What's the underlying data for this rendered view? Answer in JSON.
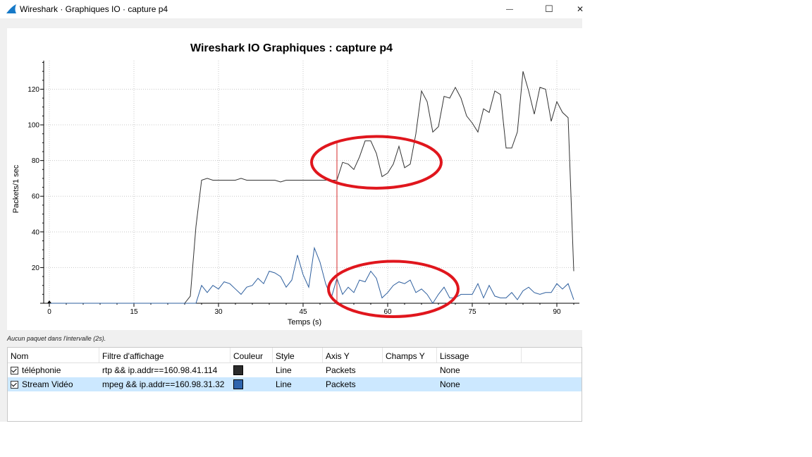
{
  "window": {
    "title": "Wireshark · Graphiques IO · capture p4",
    "minimize_glyph": "—",
    "maximize_glyph": "☐",
    "close_glyph": "✕"
  },
  "graph": {
    "title": "Wireshark IO Graphiques : capture p4",
    "status_text": "Aucun paquet dans l'intervalle (2s)."
  },
  "chart_data": {
    "type": "line",
    "title": "Wireshark IO Graphiques : capture p4",
    "xlabel": "Temps (s)",
    "ylabel": "Packets/1 sec",
    "xlim": [
      -1,
      94
    ],
    "ylim": [
      0,
      136
    ],
    "x_ticks": [
      0,
      15,
      30,
      45,
      60,
      75,
      90
    ],
    "y_ticks": [
      20,
      40,
      60,
      80,
      100,
      120
    ],
    "grid": true,
    "cursor_x": 51,
    "series": [
      {
        "name": "téléphonie",
        "color": "#333333",
        "points": [
          [
            0,
            0
          ],
          [
            1,
            0
          ],
          [
            2,
            0
          ],
          [
            3,
            0
          ],
          [
            4,
            0
          ],
          [
            5,
            0
          ],
          [
            6,
            0
          ],
          [
            7,
            0
          ],
          [
            8,
            0
          ],
          [
            9,
            0
          ],
          [
            10,
            0
          ],
          [
            11,
            0
          ],
          [
            12,
            0
          ],
          [
            13,
            0
          ],
          [
            14,
            0
          ],
          [
            15,
            0
          ],
          [
            16,
            0
          ],
          [
            17,
            0
          ],
          [
            18,
            0
          ],
          [
            19,
            0
          ],
          [
            20,
            0
          ],
          [
            21,
            0
          ],
          [
            22,
            0
          ],
          [
            23,
            0
          ],
          [
            24,
            0
          ],
          [
            25,
            4
          ],
          [
            26,
            43
          ],
          [
            27,
            69
          ],
          [
            28,
            70
          ],
          [
            29,
            69
          ],
          [
            30,
            69
          ],
          [
            31,
            69
          ],
          [
            32,
            69
          ],
          [
            33,
            69
          ],
          [
            34,
            70
          ],
          [
            35,
            69
          ],
          [
            36,
            69
          ],
          [
            37,
            69
          ],
          [
            38,
            69
          ],
          [
            39,
            69
          ],
          [
            40,
            69
          ],
          [
            41,
            68
          ],
          [
            42,
            69
          ],
          [
            43,
            69
          ],
          [
            44,
            69
          ],
          [
            45,
            69
          ],
          [
            46,
            69
          ],
          [
            47,
            69
          ],
          [
            48,
            69
          ],
          [
            49,
            69
          ],
          [
            50,
            69
          ],
          [
            51,
            69
          ],
          [
            52,
            79
          ],
          [
            53,
            78
          ],
          [
            54,
            75
          ],
          [
            55,
            82
          ],
          [
            56,
            91
          ],
          [
            57,
            91
          ],
          [
            58,
            84
          ],
          [
            59,
            71
          ],
          [
            60,
            73
          ],
          [
            61,
            78
          ],
          [
            62,
            88
          ],
          [
            63,
            76
          ],
          [
            64,
            78
          ],
          [
            65,
            95
          ],
          [
            66,
            119
          ],
          [
            67,
            113
          ],
          [
            68,
            96
          ],
          [
            69,
            99
          ],
          [
            70,
            116
          ],
          [
            71,
            115
          ],
          [
            72,
            121
          ],
          [
            73,
            115
          ],
          [
            74,
            105
          ],
          [
            75,
            101
          ],
          [
            76,
            96
          ],
          [
            77,
            109
          ],
          [
            78,
            107
          ],
          [
            79,
            119
          ],
          [
            80,
            117
          ],
          [
            81,
            87
          ],
          [
            82,
            87
          ],
          [
            83,
            96
          ],
          [
            84,
            130
          ],
          [
            85,
            119
          ],
          [
            86,
            106
          ],
          [
            87,
            121
          ],
          [
            88,
            120
          ],
          [
            89,
            102
          ],
          [
            90,
            113
          ],
          [
            91,
            107
          ],
          [
            92,
            104
          ],
          [
            93,
            18
          ]
        ]
      },
      {
        "name": "Stream Vidéo",
        "color": "#2e5f9e",
        "points": [
          [
            0,
            0
          ],
          [
            1,
            0
          ],
          [
            2,
            0
          ],
          [
            3,
            0
          ],
          [
            4,
            0
          ],
          [
            5,
            0
          ],
          [
            6,
            0
          ],
          [
            7,
            0
          ],
          [
            8,
            0
          ],
          [
            9,
            0
          ],
          [
            10,
            0
          ],
          [
            11,
            0
          ],
          [
            12,
            0
          ],
          [
            13,
            0
          ],
          [
            14,
            0
          ],
          [
            15,
            0
          ],
          [
            16,
            0
          ],
          [
            17,
            0
          ],
          [
            18,
            0
          ],
          [
            19,
            0
          ],
          [
            20,
            0
          ],
          [
            21,
            0
          ],
          [
            22,
            0
          ],
          [
            23,
            0
          ],
          [
            24,
            0
          ],
          [
            25,
            0
          ],
          [
            26,
            0
          ],
          [
            27,
            10
          ],
          [
            28,
            6
          ],
          [
            29,
            10
          ],
          [
            30,
            8
          ],
          [
            31,
            12
          ],
          [
            32,
            11
          ],
          [
            33,
            8
          ],
          [
            34,
            5
          ],
          [
            35,
            9
          ],
          [
            36,
            10
          ],
          [
            37,
            14
          ],
          [
            38,
            11
          ],
          [
            39,
            18
          ],
          [
            40,
            17
          ],
          [
            41,
            15
          ],
          [
            42,
            9
          ],
          [
            43,
            13
          ],
          [
            44,
            27
          ],
          [
            45,
            16
          ],
          [
            46,
            9
          ],
          [
            47,
            31
          ],
          [
            48,
            23
          ],
          [
            49,
            11
          ],
          [
            50,
            3
          ],
          [
            51,
            14
          ],
          [
            52,
            5
          ],
          [
            53,
            9
          ],
          [
            54,
            6
          ],
          [
            55,
            13
          ],
          [
            56,
            12
          ],
          [
            57,
            18
          ],
          [
            58,
            14
          ],
          [
            59,
            3
          ],
          [
            60,
            6
          ],
          [
            61,
            10
          ],
          [
            62,
            12
          ],
          [
            63,
            11
          ],
          [
            64,
            13
          ],
          [
            65,
            6
          ],
          [
            66,
            8
          ],
          [
            67,
            5
          ],
          [
            68,
            0
          ],
          [
            69,
            5
          ],
          [
            70,
            9
          ],
          [
            71,
            3
          ],
          [
            72,
            3
          ],
          [
            73,
            5
          ],
          [
            74,
            5
          ],
          [
            75,
            5
          ],
          [
            76,
            11
          ],
          [
            77,
            3
          ],
          [
            78,
            10
          ],
          [
            79,
            4
          ],
          [
            80,
            3
          ],
          [
            81,
            3
          ],
          [
            82,
            6
          ],
          [
            83,
            2
          ],
          [
            84,
            7
          ],
          [
            85,
            9
          ],
          [
            86,
            6
          ],
          [
            87,
            5
          ],
          [
            88,
            6
          ],
          [
            89,
            6
          ],
          [
            90,
            11
          ],
          [
            91,
            8
          ],
          [
            92,
            11
          ],
          [
            93,
            2
          ]
        ]
      }
    ],
    "annotations": [
      {
        "shape": "ellipse",
        "color": "#e0161d",
        "cx": 58,
        "cy": 79,
        "rx": 11.5,
        "ry": 14.5
      },
      {
        "shape": "ellipse",
        "color": "#e0161d",
        "cx": 61,
        "cy": 8,
        "rx": 11.5,
        "ry": 15.5
      }
    ]
  },
  "table": {
    "headers": [
      "Nom",
      "Filtre d'affichage",
      "Couleur",
      "Style",
      "Axis Y",
      "Champs Y",
      "Lissage"
    ],
    "rows": [
      {
        "checked": true,
        "name": "téléphonie",
        "filter": "rtp && ip.addr==160.98.41.114",
        "color": "#2b2b2b",
        "style": "Line",
        "axis_y": "Packets",
        "field_y": "",
        "smoothing": "None"
      },
      {
        "checked": true,
        "name": "Stream Vidéo",
        "filter": "mpeg && ip.addr==160.98.31.32",
        "color": "#2e64ad",
        "style": "Line",
        "axis_y": "Packets",
        "field_y": "",
        "smoothing": "None"
      }
    ]
  }
}
